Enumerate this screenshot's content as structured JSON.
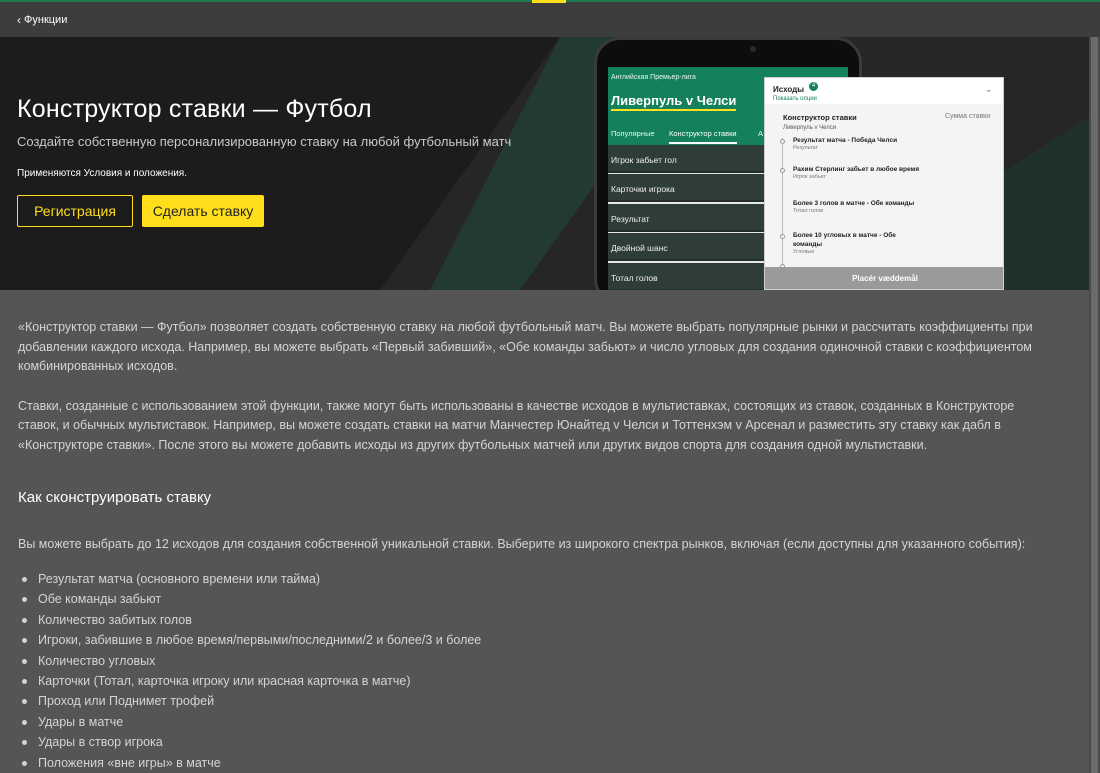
{
  "topbar": {
    "back_label": "Функции"
  },
  "hero": {
    "title": "Конструктор ставки — Футбол",
    "subtitle": "Создайте собственную персонализированную ставку на любой футбольный матч",
    "terms": "Применяются Условия и положения.",
    "register_label": "Регистрация",
    "bet_label": "Сделать ставку",
    "accent_color": "#ffdf1b",
    "brand_color": "#14805e"
  },
  "phone": {
    "league": "Английская Премьер-лига",
    "match": "Ливерпуль v Челси",
    "tabs": [
      "Популярные",
      "Конструктор ставки",
      "А"
    ],
    "markets": [
      "Игрок забьет гол",
      "Карточки игрока",
      "Результат",
      "Двойной шанс",
      "Тотал голов"
    ]
  },
  "betslip": {
    "header": "Исходы",
    "badge": "4",
    "show_options": "Показать опции",
    "title": "Конструктор ставки",
    "subtitle": "Ливерпуль v Челси",
    "amount_label": "Сумма ставки",
    "items": [
      {
        "name": "Результат матча - Победа Челси",
        "market": "Результат"
      },
      {
        "name": "Рахим Стерлинг забьет в любое время",
        "market": "Игрок забьет"
      },
      {
        "name": "Более 3 голов в матче - Обе команды",
        "market": "Тотал голов"
      },
      {
        "name": "Более 10 угловых в матче - Обе команды",
        "market": "Угловые"
      }
    ],
    "place_label": "Placér væddemål"
  },
  "content": {
    "para1": "«Конструктор ставки — Футбол» позволяет создать собственную ставку на любой футбольный матч. Вы можете выбрать популярные рынки и рассчитать коэффициенты при добавлении каждого исхода. Например, вы можете выбрать «Первый забивший», «Обе команды забьют» и число угловых для создания одиночной ставки с коэффициентом комбинированных исходов.",
    "para2": "Ставки, созданные с использованием этой функции, также могут быть использованы в качестве исходов в мультиставках, состоящих из ставок, созданных в Конструкторе ставок, и обычных мультиставок. Например, вы можете создать ставки на матчи Манчестер Юнайтед v Челси и Тоттенхэм v Арсенал и разместить эту ставку как дабл в «Конструкторе ставки». После этого вы можете добавить исходы из других футбольных матчей или других видов спорта для создания одной мультиставки.",
    "heading": "Как сконструировать ставку",
    "intro": "Вы можете выбрать до 12 исходов для создания собственной уникальной ставки. Выберите из широкого спектра рынков, включая (если доступны для указанного события):",
    "list": [
      "Результат матча (основного времени или тайма)",
      "Обе команды забьют",
      "Количество забитых голов",
      "Игроки, забившие в любое время/первыми/последними/2 и более/3 и более",
      "Количество угловых",
      "Карточки (Тотал, карточка игроку или красная карточка в матче)",
      "Проход или Поднимет трофей",
      "Удары в матче",
      "Удары в створ игрока",
      "Положения «вне игры» в матче"
    ]
  }
}
